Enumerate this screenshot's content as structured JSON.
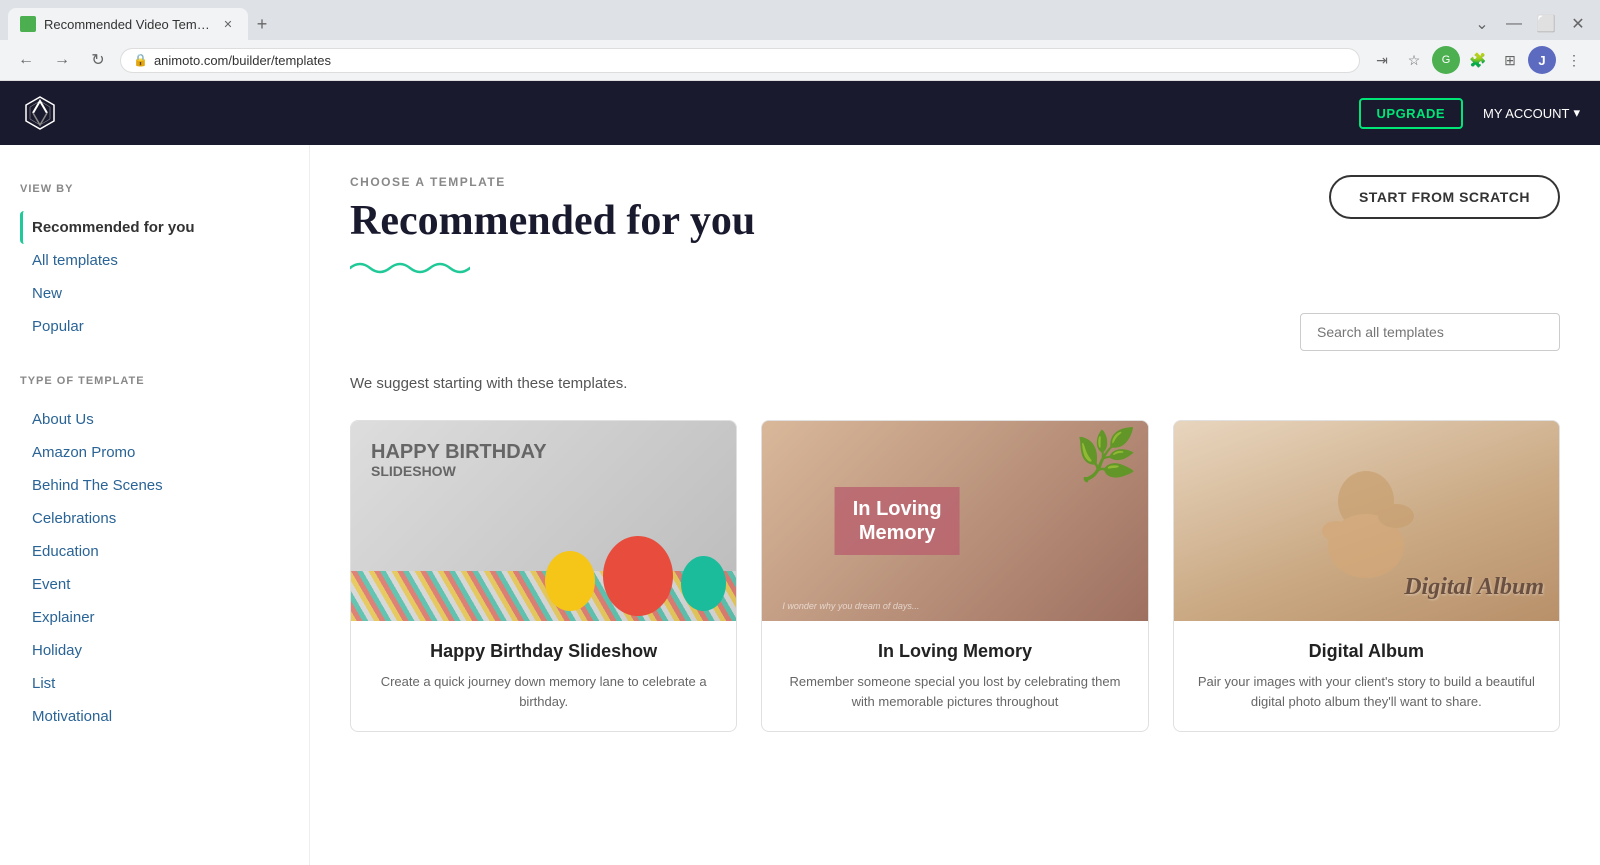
{
  "browser": {
    "tab_title": "Recommended Video Templates",
    "tab_favicon": "▲",
    "url": "animoto.com/builder/templates",
    "new_tab_icon": "+",
    "back_icon": "←",
    "forward_icon": "→",
    "refresh_icon": "↻",
    "bookmark_icon": "☆",
    "profile_initial": "J",
    "window_minimize": "—",
    "window_maximize": "⬜",
    "window_close": "✕",
    "dropdown_icon": "⋮"
  },
  "header": {
    "upgrade_label": "UPGRADE",
    "my_account_label": "MY ACCOUNT",
    "chevron": "▾"
  },
  "sidebar": {
    "view_by_label": "VIEW BY",
    "type_label": "TYPE OF TEMPLATE",
    "view_items": [
      {
        "id": "recommended",
        "label": "Recommended for you",
        "active": true
      },
      {
        "id": "all",
        "label": "All templates",
        "active": false
      },
      {
        "id": "new",
        "label": "New",
        "active": false
      },
      {
        "id": "popular",
        "label": "Popular",
        "active": false
      }
    ],
    "type_items": [
      {
        "id": "about-us",
        "label": "About Us"
      },
      {
        "id": "amazon-promo",
        "label": "Amazon Promo"
      },
      {
        "id": "behind-scenes",
        "label": "Behind The Scenes"
      },
      {
        "id": "celebrations",
        "label": "Celebrations"
      },
      {
        "id": "education",
        "label": "Education"
      },
      {
        "id": "event",
        "label": "Event"
      },
      {
        "id": "explainer",
        "label": "Explainer"
      },
      {
        "id": "holiday",
        "label": "Holiday"
      },
      {
        "id": "list",
        "label": "List"
      },
      {
        "id": "motivational",
        "label": "Motivational"
      }
    ]
  },
  "content": {
    "choose_label": "CHOOSE A TEMPLATE",
    "page_title": "Recommended for you",
    "wave": "∿∿∿∿",
    "suggest_text": "We suggest starting with these templates.",
    "start_scratch_label": "START FROM SCRATCH",
    "search_placeholder": "Search all templates",
    "templates": [
      {
        "id": "birthday",
        "title": "Happy Birthday Slideshow",
        "description": "Create a quick journey down memory lane to celebrate a birthday."
      },
      {
        "id": "memory",
        "title": "In Loving Memory",
        "description": "Remember someone special you lost by celebrating them with memorable pictures throughout"
      },
      {
        "id": "album",
        "title": "Digital Album",
        "description": "Pair your images with your client's story to build a beautiful digital photo album they'll want to share."
      }
    ]
  },
  "colors": {
    "accent_teal": "#20c997",
    "upgrade_green": "#00e676",
    "header_dark": "#1a1a2e",
    "link_blue": "#2a6496"
  }
}
